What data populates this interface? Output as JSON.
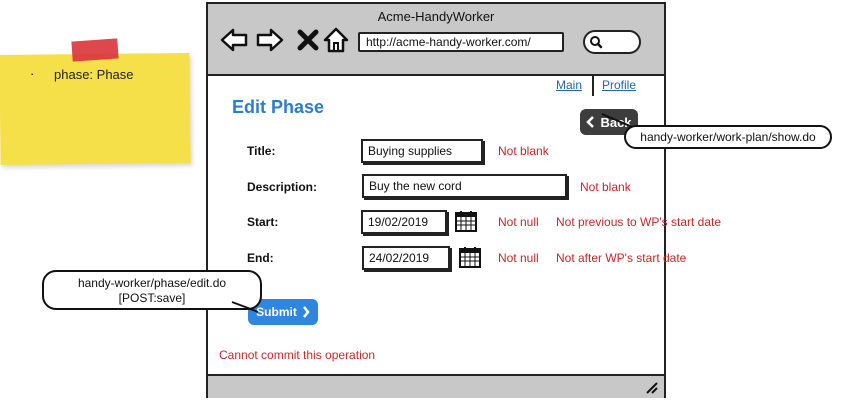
{
  "sticky_note": {
    "bullet": "·",
    "text": "phase: Phase"
  },
  "browser": {
    "title": "Acme-HandyWorker",
    "url": "http://acme-handy-worker.com/",
    "icons": [
      "back-arrow-icon",
      "forward-arrow-icon",
      "close-icon",
      "home-icon",
      "search-icon"
    ]
  },
  "nav": {
    "main_link": "Main",
    "profile_link": "Profile"
  },
  "page": {
    "heading": "Edit Phase",
    "back_button": "Back",
    "fields": {
      "title": {
        "label": "Title:",
        "value": "Buying supplies",
        "errors": [
          "Not blank"
        ]
      },
      "description": {
        "label": "Description:",
        "value": "Buy the new cord",
        "errors": [
          "Not blank"
        ]
      },
      "start": {
        "label": "Start:",
        "value": "19/02/2019",
        "errors": [
          "Not null",
          "Not previous to WP's start date"
        ]
      },
      "end": {
        "label": "End:",
        "value": "24/02/2019",
        "errors": [
          "Not null",
          "Not after WP's start date"
        ]
      }
    },
    "submit_button": "Submit",
    "commit_error": "Cannot commit this operation"
  },
  "callouts": {
    "back_target": "handy-worker/work-plan/show.do",
    "submit_target_line1": "handy-worker/phase/edit.do",
    "submit_target_line2": "[POST:save]"
  },
  "colors": {
    "heading": "#2e7bd6",
    "error": "#c62828",
    "link": "#2563b0",
    "submit": "#2e86de",
    "back": "#3d3d3d",
    "sticky": "#f6e04a",
    "chrome": "#c8c8c8"
  }
}
